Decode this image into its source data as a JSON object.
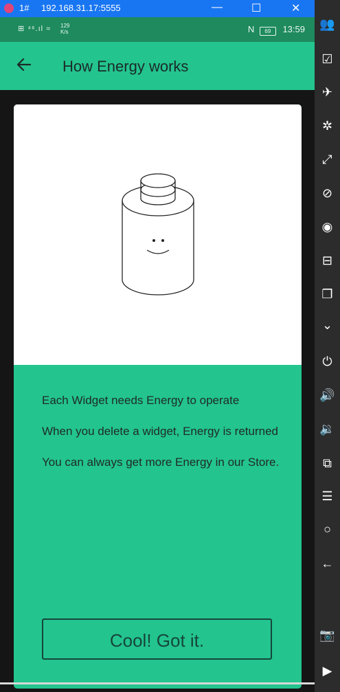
{
  "window": {
    "instance": "1#",
    "address": "192.168.31.17:5555",
    "controls": {
      "minimize": "—",
      "maximize": "☐",
      "close": "✕"
    }
  },
  "status_bar": {
    "left_icons": "⊞ ⁴⁶.ıl ≈",
    "net_speed": "129",
    "net_unit": "K/s",
    "nfc": "N",
    "battery": "69",
    "time": "13:59"
  },
  "header": {
    "back_icon": "arrow-left-icon",
    "title": "How Energy works"
  },
  "card": {
    "paragraphs": [
      "Each Widget needs Energy to operate",
      "When you delete a widget, Energy is returned",
      "You can always get more Energy in our Store."
    ],
    "button_label": "Cool! Got it."
  },
  "colors": {
    "accent": "#23c48e",
    "status": "#1e8a5e",
    "window_bar": "#1976f2"
  },
  "sidebar_tools": [
    {
      "icon": "users-icon",
      "glyph": "👥"
    },
    {
      "icon": "checkbox-icon",
      "glyph": "☑"
    },
    {
      "icon": "airplane-icon",
      "glyph": "✈"
    },
    {
      "icon": "settings-icon",
      "glyph": "✲"
    },
    {
      "icon": "fullscreen-icon",
      "glyph": "⤢"
    },
    {
      "icon": "eye-off-icon",
      "glyph": "⊘"
    },
    {
      "icon": "eye-icon",
      "glyph": "◉"
    },
    {
      "icon": "minus-box-icon",
      "glyph": "⊟"
    },
    {
      "icon": "copy-icon",
      "glyph": "❐"
    },
    {
      "icon": "chevrons-down-icon",
      "glyph": "⌄"
    },
    {
      "icon": "power-icon",
      "glyph": "⏻"
    },
    {
      "icon": "volume-up-icon",
      "glyph": "🔊"
    },
    {
      "icon": "volume-down-icon",
      "glyph": "🔉"
    },
    {
      "icon": "windows-icon",
      "glyph": "⧉"
    },
    {
      "icon": "menu-icon",
      "glyph": "☰"
    },
    {
      "icon": "home-circle-icon",
      "glyph": "○"
    },
    {
      "icon": "back-arrow-icon",
      "glyph": "←"
    },
    {
      "icon": "camera-icon",
      "glyph": "📷"
    },
    {
      "icon": "video-icon",
      "glyph": "▶"
    }
  ]
}
